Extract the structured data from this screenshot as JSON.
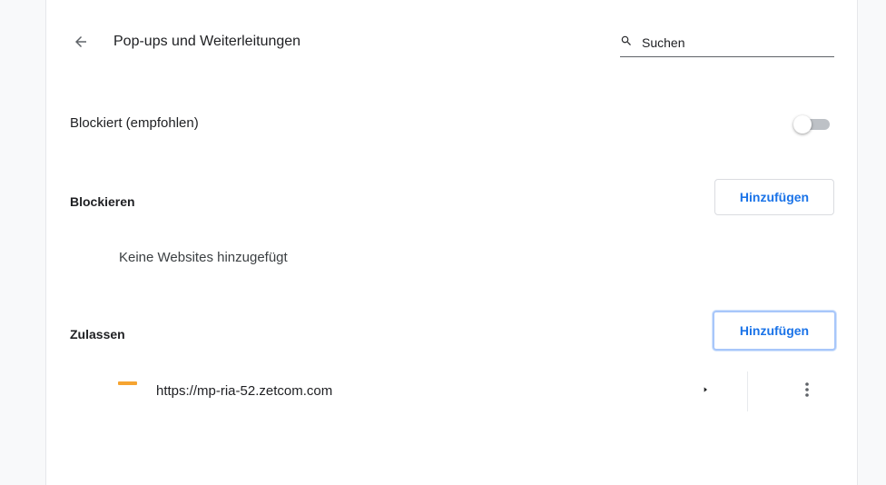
{
  "header": {
    "title": "Pop-ups und Weiterleitungen",
    "search_placeholder": "Suchen"
  },
  "blocked_setting": {
    "label": "Blockiert (empfohlen)",
    "enabled": false
  },
  "block_section": {
    "title": "Blockieren",
    "add_button": "Hinzufügen",
    "empty_text": "Keine Websites hinzugefügt"
  },
  "allow_section": {
    "title": "Zulassen",
    "add_button": "Hinzufügen",
    "sites": [
      {
        "url": "https://mp-ria-52.zetcom.com"
      }
    ]
  },
  "colors": {
    "accent": "#1a73e8",
    "favicon": "#f6a431",
    "toggle_off_track": "#bdc1c6"
  },
  "icons": [
    "arrow-back-icon",
    "search-icon",
    "arrow-right-icon",
    "more-vert-icon"
  ]
}
